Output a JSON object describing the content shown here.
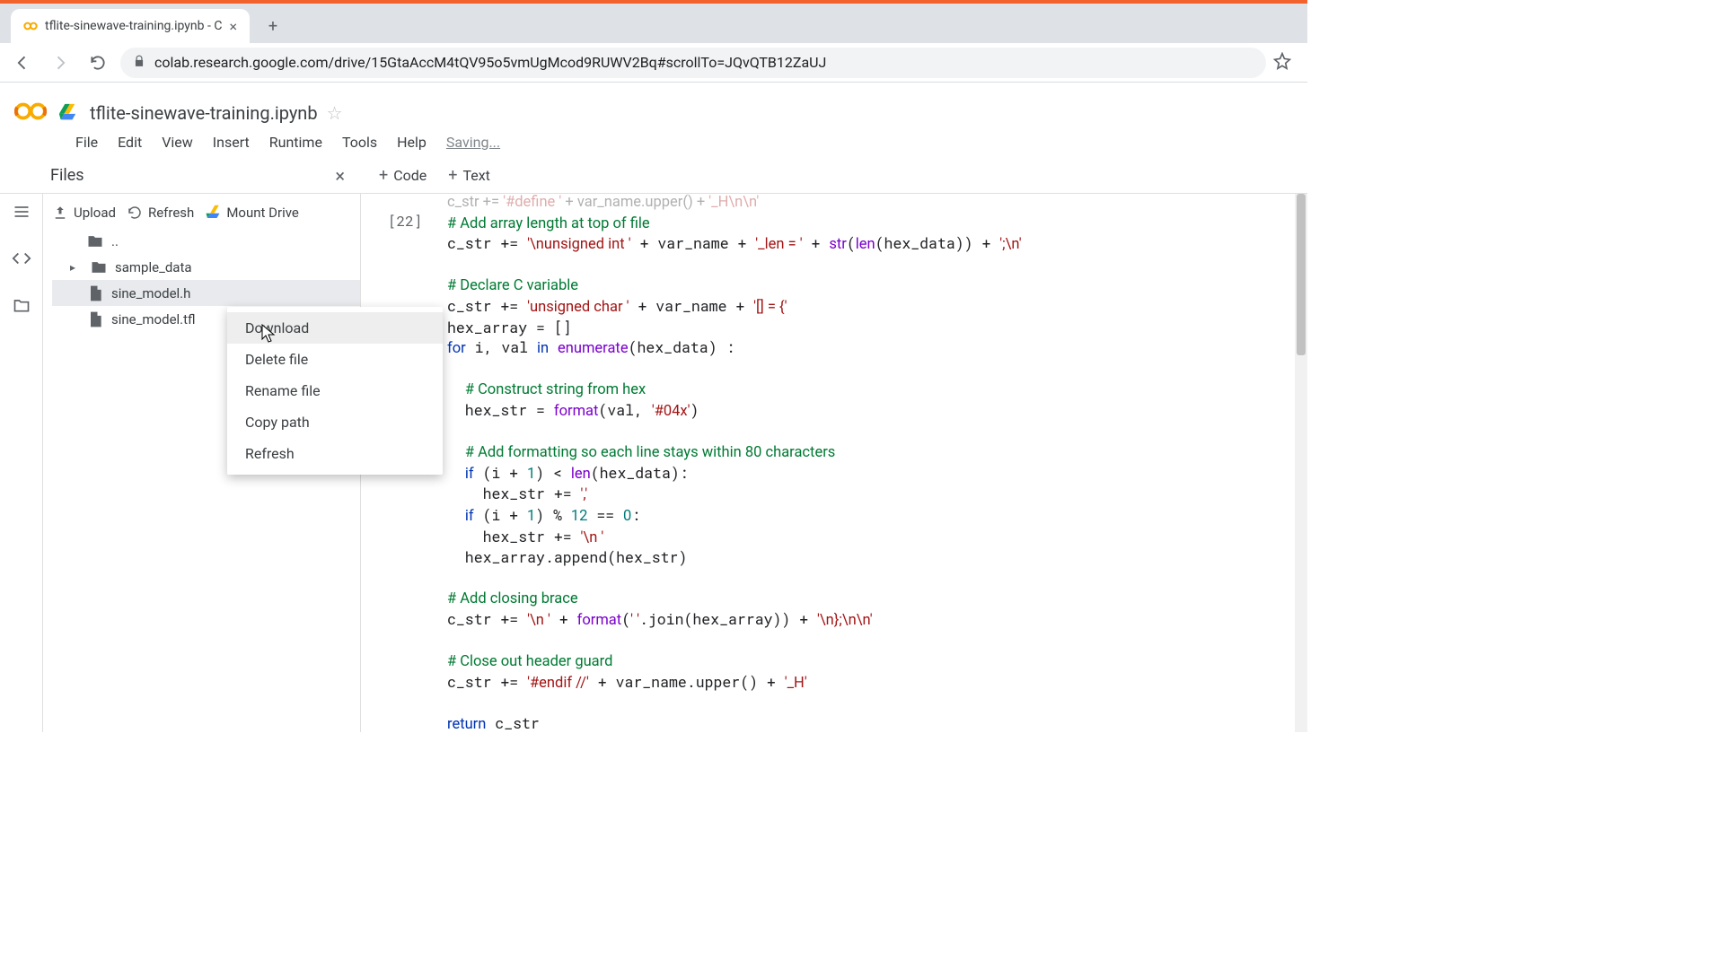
{
  "browser": {
    "tab_title": "tflite-sinewave-training.ipynb - C",
    "url": "colab.research.google.com/drive/15GtaAccM4tQV95o5vmUgMcod9RUWV2Bq#scrollTo=JQvQTB12ZaUJ"
  },
  "colab": {
    "doc_name": "tflite-sinewave-training.ipynb",
    "menus": [
      "File",
      "Edit",
      "View",
      "Insert",
      "Runtime",
      "Tools",
      "Help"
    ],
    "status": "Saving...",
    "add_code": "Code",
    "add_text": "Text"
  },
  "files_panel": {
    "title": "Files",
    "actions": {
      "upload": "Upload",
      "refresh": "Refresh",
      "mount": "Mount Drive"
    },
    "parent": "..",
    "items": [
      {
        "name": "sample_data",
        "type": "folder"
      },
      {
        "name": "sine_model.h",
        "type": "file",
        "selected": true
      },
      {
        "name": "sine_model.tfl",
        "type": "file"
      }
    ]
  },
  "context_menu": {
    "items": [
      "Download",
      "Delete file",
      "Rename file",
      "Copy path",
      "Refresh"
    ],
    "hover_index": 0
  },
  "cell": {
    "prompt": "[22]",
    "code_tokens": [
      [
        "op",
        "c_str "
      ],
      [
        "op",
        ""
      ],
      [
        "op",
        ""
      ],
      [
        "str",
        "'#define '"
      ],
      [
        "op",
        ""
      ],
      [
        "op",
        ""
      ],
      [
        "op",
        "var_name.upper()"
      ],
      [
        "op",
        ""
      ],
      [
        "op",
        ""
      ],
      [
        "str",
        "'_H\\n\\n'"
      ],
      [
        "nl",
        ""
      ],
      [
        "nl",
        ""
      ],
      [
        "cm",
        "# Add array length at top of file"
      ],
      [
        "nl",
        ""
      ],
      [
        "op",
        "c_str += "
      ],
      [
        "str",
        "'\\nunsigned int '"
      ],
      [
        "op",
        " + var_name + "
      ],
      [
        "str",
        "'_len = '"
      ],
      [
        "op",
        " + "
      ],
      [
        "fn",
        "str"
      ],
      [
        "op",
        "("
      ],
      [
        "fn",
        "len"
      ],
      [
        "op",
        "(hex_data)) + "
      ],
      [
        "str",
        "';\\n'"
      ],
      [
        "nl",
        ""
      ],
      [
        "nl",
        ""
      ],
      [
        "cm",
        "# Declare C variable"
      ],
      [
        "nl",
        ""
      ],
      [
        "op",
        "c_str += "
      ],
      [
        "str",
        "'unsigned char '"
      ],
      [
        "op",
        " + var_name + "
      ],
      [
        "str",
        "'[] = {'"
      ],
      [
        "nl",
        ""
      ],
      [
        "op",
        "hex_array = []"
      ],
      [
        "nl",
        ""
      ],
      [
        "kw",
        "for"
      ],
      [
        "op",
        " i, val "
      ],
      [
        "kw",
        "in"
      ],
      [
        "op",
        " "
      ],
      [
        "fn",
        "enumerate"
      ],
      [
        "op",
        "(hex_data) :"
      ],
      [
        "nl",
        ""
      ],
      [
        "nl",
        ""
      ],
      [
        "op",
        "  "
      ],
      [
        "cm",
        "# Construct string from hex"
      ],
      [
        "nl",
        ""
      ],
      [
        "op",
        "  hex_str = "
      ],
      [
        "fn",
        "format"
      ],
      [
        "op",
        "(val, "
      ],
      [
        "str",
        "'#04x'"
      ],
      [
        "op",
        ")"
      ],
      [
        "nl",
        ""
      ],
      [
        "nl",
        ""
      ],
      [
        "op",
        "  "
      ],
      [
        "cm",
        "# Add formatting so each line stays within 80 characters"
      ],
      [
        "nl",
        ""
      ],
      [
        "op",
        "  "
      ],
      [
        "kw",
        "if"
      ],
      [
        "op",
        " (i + "
      ],
      [
        "num",
        "1"
      ],
      [
        "op",
        ") < "
      ],
      [
        "fn",
        "len"
      ],
      [
        "op",
        "(hex_data):"
      ],
      [
        "nl",
        ""
      ],
      [
        "op",
        "    hex_str += "
      ],
      [
        "str",
        "','"
      ],
      [
        "nl",
        ""
      ],
      [
        "op",
        "  "
      ],
      [
        "kw",
        "if"
      ],
      [
        "op",
        " (i + "
      ],
      [
        "num",
        "1"
      ],
      [
        "op",
        ") % "
      ],
      [
        "num",
        "12"
      ],
      [
        "op",
        " == "
      ],
      [
        "num",
        "0"
      ],
      [
        "op",
        ":"
      ],
      [
        "nl",
        ""
      ],
      [
        "op",
        "    hex_str += "
      ],
      [
        "str",
        "'\\n '"
      ],
      [
        "nl",
        ""
      ],
      [
        "op",
        "  hex_array.append(hex_str)"
      ],
      [
        "nl",
        ""
      ],
      [
        "nl",
        ""
      ],
      [
        "cm",
        "# Add closing brace"
      ],
      [
        "nl",
        ""
      ],
      [
        "op",
        "c_str += "
      ],
      [
        "str",
        "'\\n '"
      ],
      [
        "op",
        " + "
      ],
      [
        "fn",
        "format"
      ],
      [
        "op",
        "("
      ],
      [
        "str",
        "' '"
      ],
      [
        "op",
        ".join(hex_array)) + "
      ],
      [
        "str",
        "'\\n};\\n\\n'"
      ],
      [
        "nl",
        ""
      ],
      [
        "nl",
        ""
      ],
      [
        "cm",
        "# Close out header guard"
      ],
      [
        "nl",
        ""
      ],
      [
        "op",
        "c_str += "
      ],
      [
        "str",
        "'#endif //'"
      ],
      [
        "op",
        " + var_name.upper() + "
      ],
      [
        "str",
        "'_H'"
      ],
      [
        "nl",
        ""
      ],
      [
        "nl",
        ""
      ],
      [
        "kw",
        "return"
      ],
      [
        "op",
        " c_str"
      ]
    ]
  }
}
